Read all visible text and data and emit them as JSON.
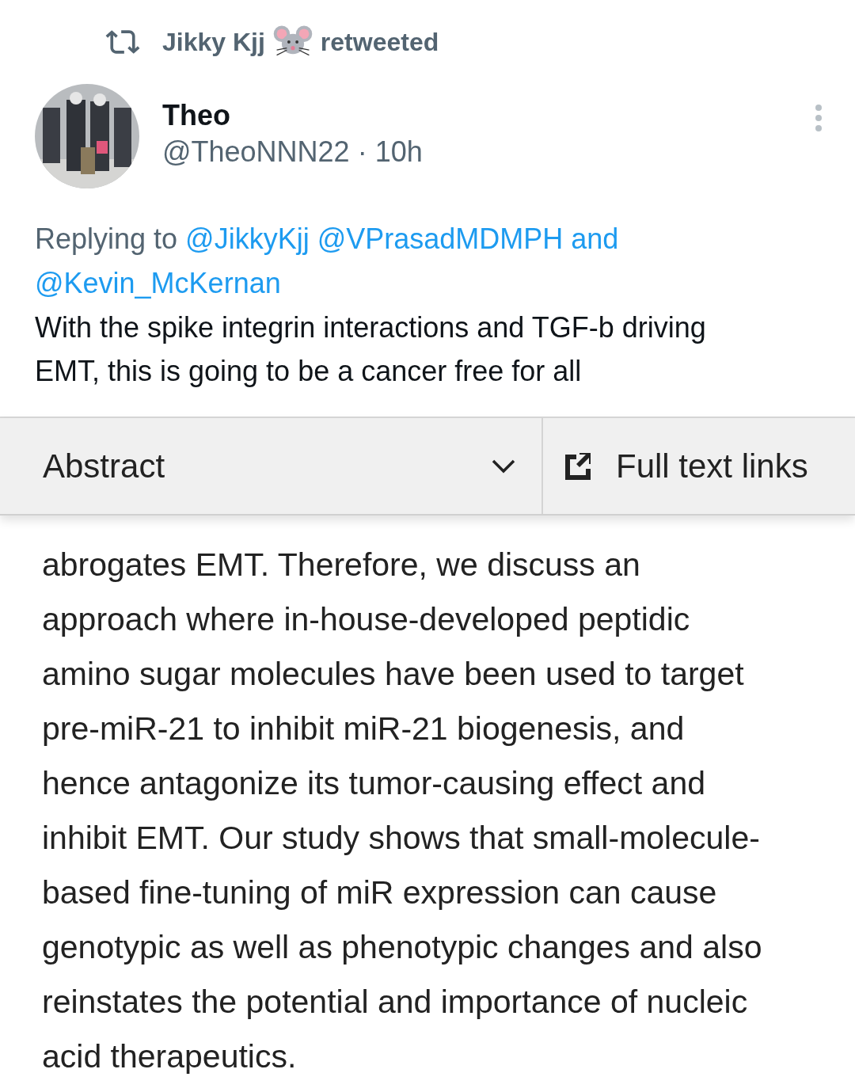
{
  "retweet": {
    "user": "Jikky Kjj",
    "action": "retweeted"
  },
  "author": {
    "name": "Theo",
    "handle": "@TheoNNN22",
    "separator": "·",
    "time": "10h"
  },
  "reply": {
    "prefix": "Replying to",
    "mentions": [
      "@JikkyKjj",
      "@VPrasadMDMPH"
    ],
    "joiner": "and",
    "last_mention": "@Kevin_McKernan"
  },
  "text": "With the spike integrin interactions and TGF-b driving EMT, this is going to be a cancer free for all",
  "embedded": {
    "section": "Abstract",
    "links": "Full text links",
    "paragraph": "abrogates EMT. Therefore, we discuss an approach where in-house-developed peptidic amino sugar molecules have been used to target pre-miR-21 to inhibit miR-21 biogenesis, and hence antagonize its tumor-causing effect and inhibit EMT. Our study shows that small-molecule-based fine-tuning of miR expression can cause genotypic as well as phenotypic changes and also reinstates the potential and importance of nucleic acid therapeutics."
  }
}
